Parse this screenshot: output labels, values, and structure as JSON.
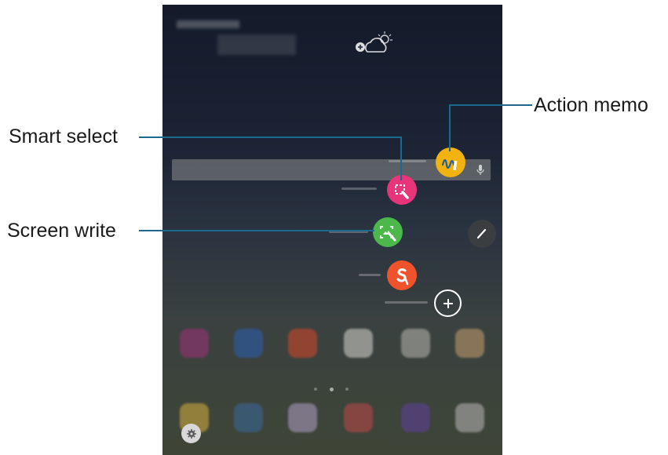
{
  "callouts": {
    "smart_select": "Smart select",
    "screen_write": "Screen write",
    "action_memo": "Action memo"
  },
  "colors": {
    "action_memo": "#f2b20f",
    "smart_select": "#e8357a",
    "screen_write": "#4cb84c",
    "s_note": "#f0522c",
    "callout_line": "#1a6a8e"
  },
  "icons": {
    "action_memo": "wave-pen-icon",
    "smart_select": "crop-pen-icon",
    "screen_write": "image-pen-icon",
    "s_note": "s-note-icon",
    "add_shortcut": "plus-icon",
    "pen": "pen-icon",
    "settings": "gear-icon"
  }
}
